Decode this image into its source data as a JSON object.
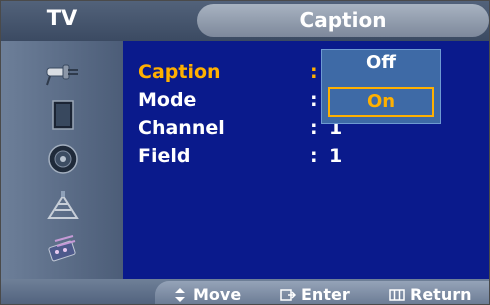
{
  "header": {
    "source_label": "TV",
    "title": "Caption"
  },
  "sidebar": {
    "icons": [
      "input-icon",
      "picture-icon",
      "sound-icon",
      "channel-icon",
      "setup-icon"
    ]
  },
  "menu": {
    "rows": [
      {
        "label": "Caption",
        "colon": ":",
        "value": ""
      },
      {
        "label": "Mode",
        "colon": ":",
        "value": ""
      },
      {
        "label": "Channel",
        "colon": ":",
        "value": "1"
      },
      {
        "label": "Field",
        "colon": ":",
        "value": "1"
      }
    ],
    "active_row": "Caption"
  },
  "dropdown": {
    "options": [
      "Off",
      "On"
    ],
    "selected": "On"
  },
  "footer": {
    "move_label": "Move",
    "enter_label": "Enter",
    "return_label": "Return"
  },
  "colors": {
    "accent": "#ffb000",
    "background": "#0a1a8c"
  }
}
